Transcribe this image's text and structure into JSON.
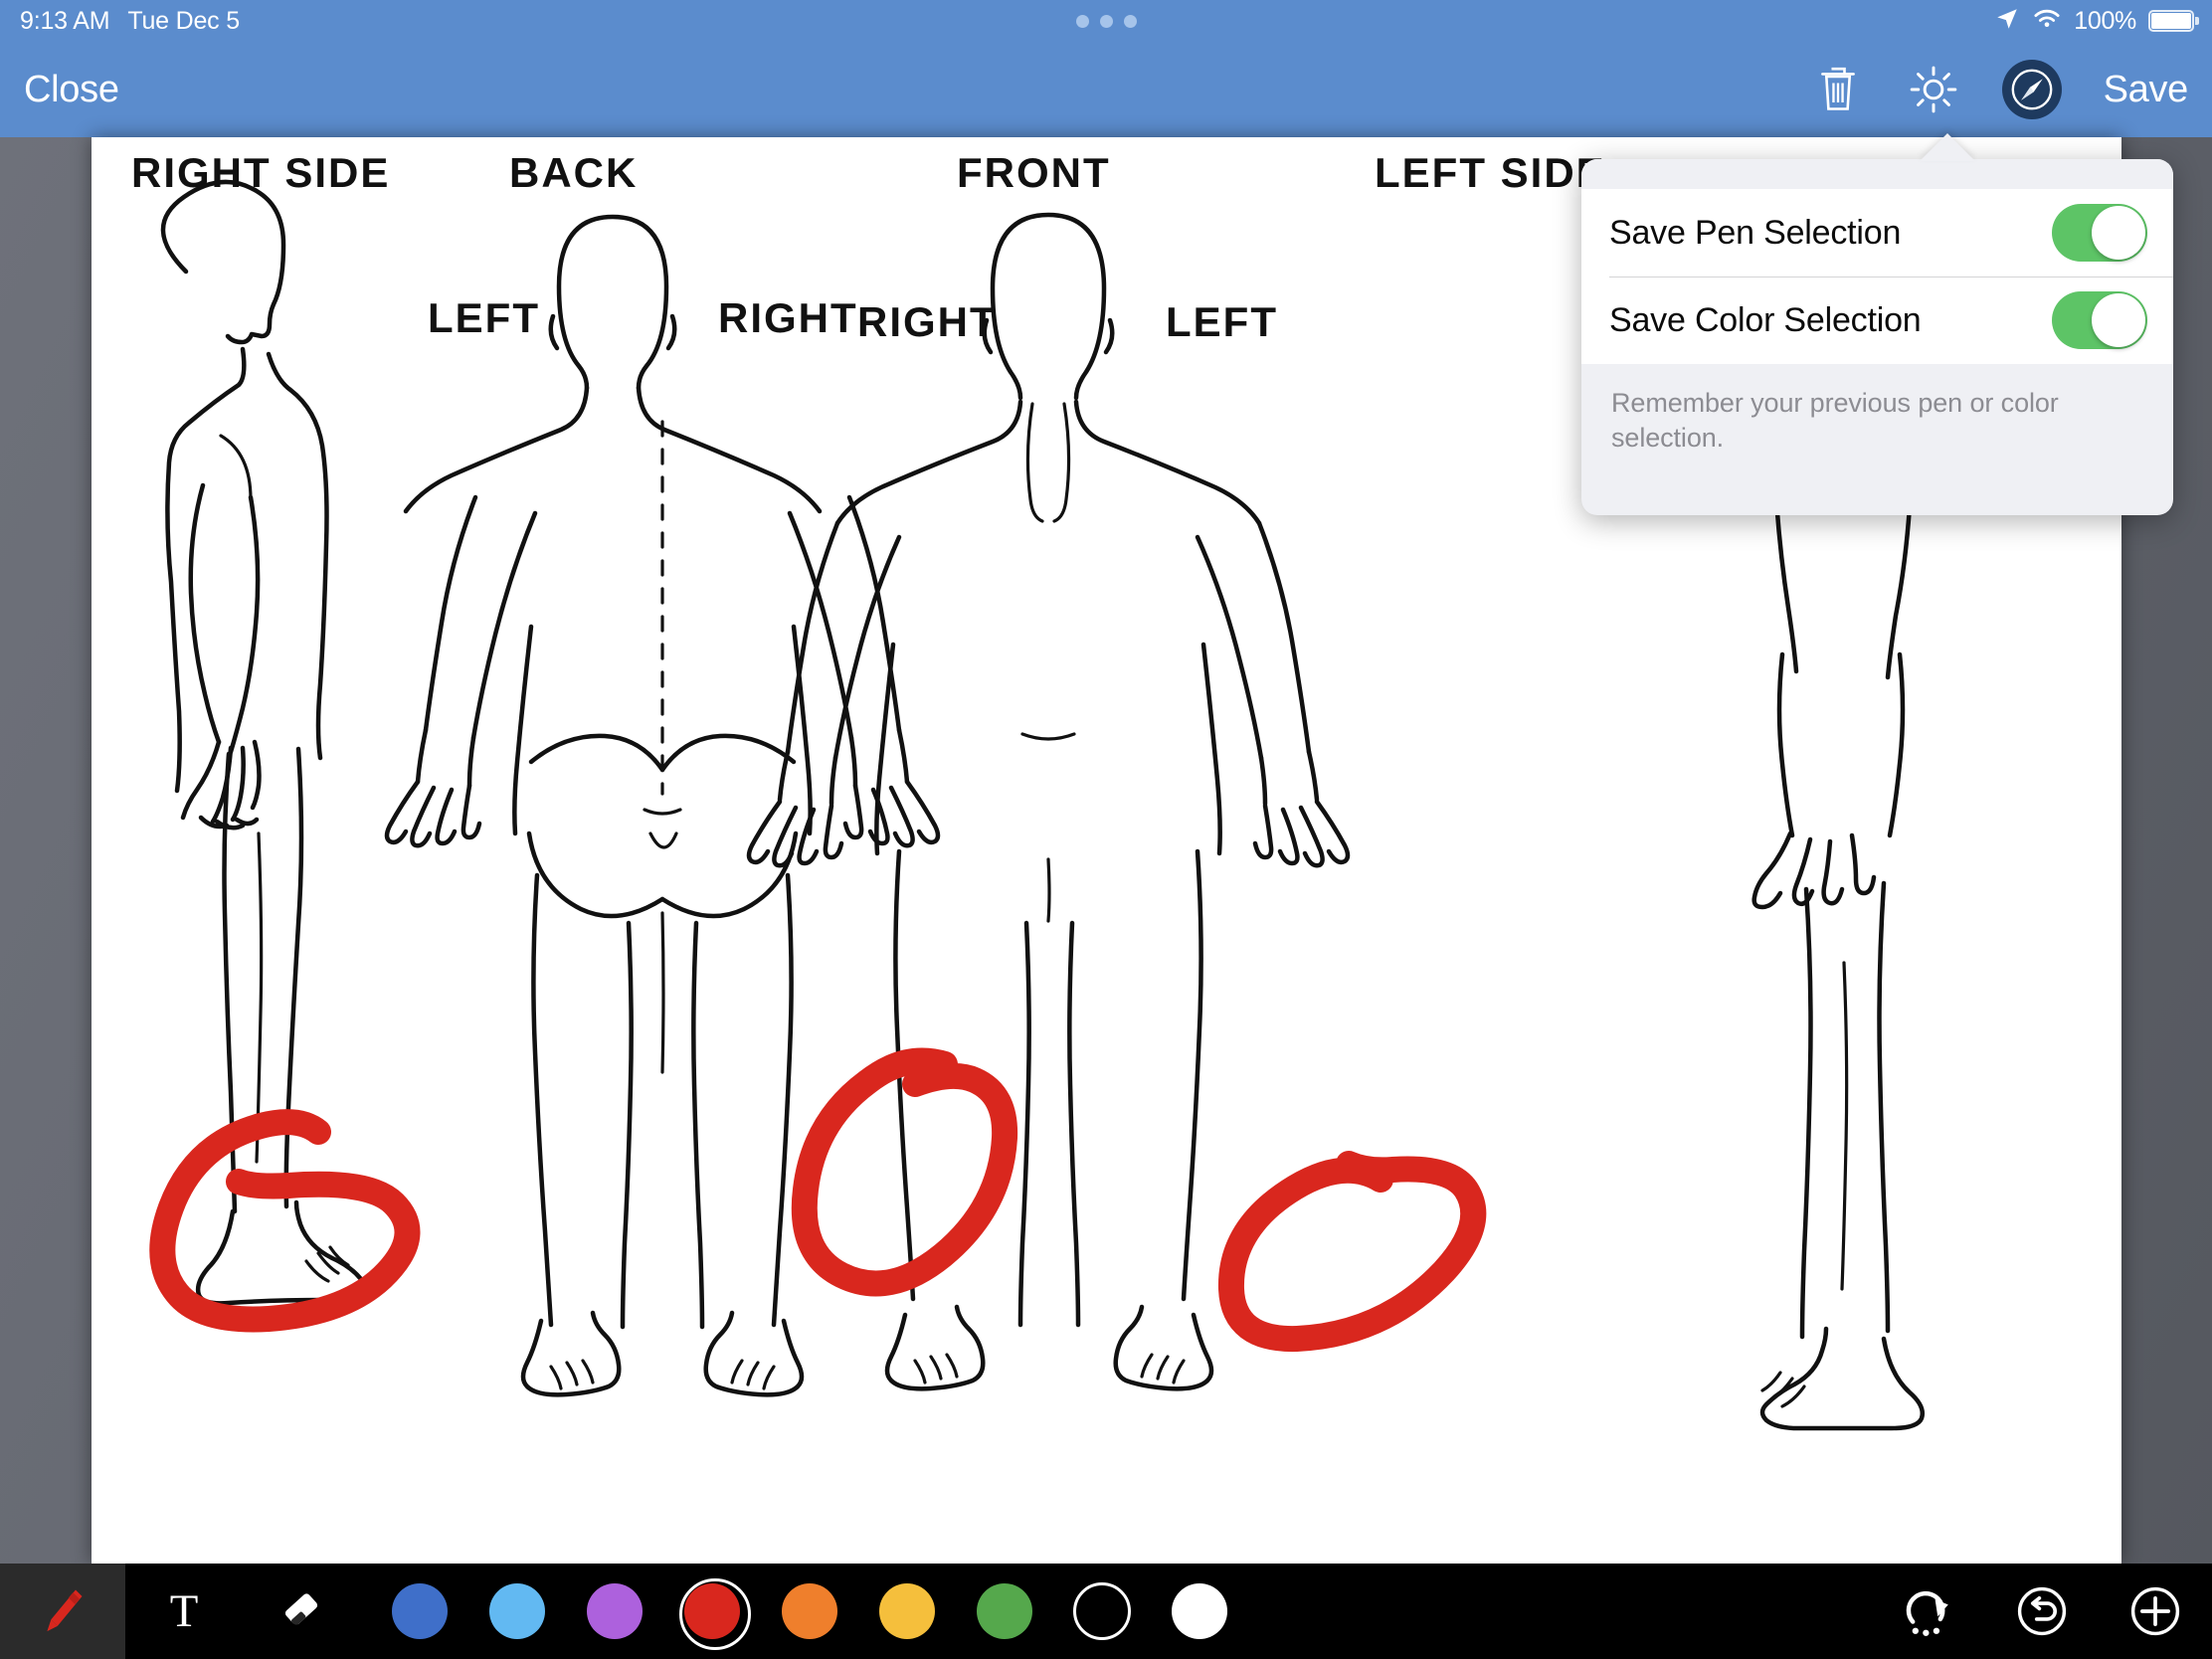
{
  "statusbar": {
    "time": "9:13 AM",
    "date": "Tue Dec 5",
    "battery_percent": "100%",
    "location_icon": "location-arrow-icon",
    "wifi_icon": "wifi-icon",
    "battery_icon": "battery-icon",
    "dots": "multitasking-dots"
  },
  "navbar": {
    "close_label": "Close",
    "save_label": "Save",
    "trash_icon": "trash-icon",
    "gear_icon": "gear-icon",
    "compass_icon": "compass-icon"
  },
  "popover": {
    "rows": [
      {
        "label": "Save Pen Selection",
        "value": "on"
      },
      {
        "label": "Save Color Selection",
        "value": "on"
      }
    ],
    "footer": "Remember your previous pen or color selection.",
    "toggle_on_color": "#5dc466"
  },
  "canvas": {
    "diagram_title": "body-chart",
    "labels": {
      "right_side": "RIGHT SIDE",
      "back": "BACK",
      "front": "FRONT",
      "left_side": "LEFT SIDE",
      "back_left": "LEFT",
      "back_right": "RIGHT",
      "front_right": "RIGHT",
      "front_left": "LEFT"
    },
    "annotation_color": "#d9271e",
    "annotation_count": "3"
  },
  "toolbar": {
    "pen_icon": "pen-icon",
    "text_icon": "text-tool-icon",
    "eraser_icon": "eraser-icon",
    "redo_icon": "redo-icon",
    "undo_icon": "undo-icon",
    "add_icon": "plus-icon",
    "colors": [
      {
        "name": "blue",
        "hex": "#3f6fc9",
        "selected": false
      },
      {
        "name": "light-blue",
        "hex": "#62b9f2",
        "selected": false
      },
      {
        "name": "purple",
        "hex": "#ad61dd",
        "selected": false
      },
      {
        "name": "red",
        "hex": "#d9271e",
        "selected": true
      },
      {
        "name": "orange",
        "hex": "#ef7f2c",
        "selected": false
      },
      {
        "name": "yellow",
        "hex": "#f5bf3c",
        "selected": false
      },
      {
        "name": "green",
        "hex": "#55a84c",
        "selected": false
      },
      {
        "name": "black",
        "hex": "#000000",
        "selected": false
      },
      {
        "name": "white",
        "hex": "#ffffff",
        "selected": false
      }
    ]
  }
}
